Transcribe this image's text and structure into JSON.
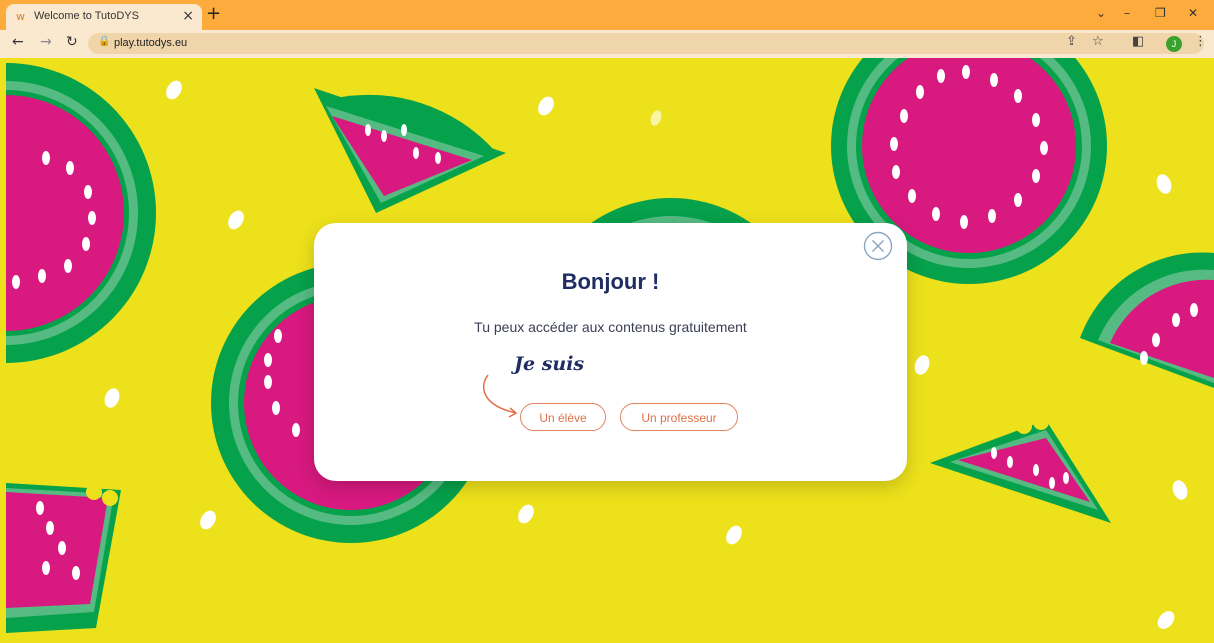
{
  "browser": {
    "tab_title": "Welcome to TutoDYS",
    "tab_close": "×",
    "new_tab": "+",
    "url": "play.tutodys.eu",
    "avatar_letter": "J",
    "icons": [
      "back-arrow-icon",
      "forward-arrow-icon",
      "reload-icon",
      "lock-icon",
      "share-icon",
      "star-icon",
      "sidepanel-icon",
      "menu-dots-icon"
    ]
  },
  "modal": {
    "title": "Bonjour !",
    "subtitle": "Tu peux accéder aux contenus gratuitement",
    "je_suis": "Je suis",
    "buttons": [
      {
        "label": "Un élève"
      },
      {
        "label": "Un professeur"
      }
    ]
  },
  "colors": {
    "background": "#ede11b",
    "tabbar": "#fdab3c",
    "toolbar": "#fbe9cf",
    "accent_orange": "#e0714a",
    "title_blue": "#1f2d63",
    "watermelon_pink": "#d8197f",
    "rind_green": "#06a14b"
  }
}
